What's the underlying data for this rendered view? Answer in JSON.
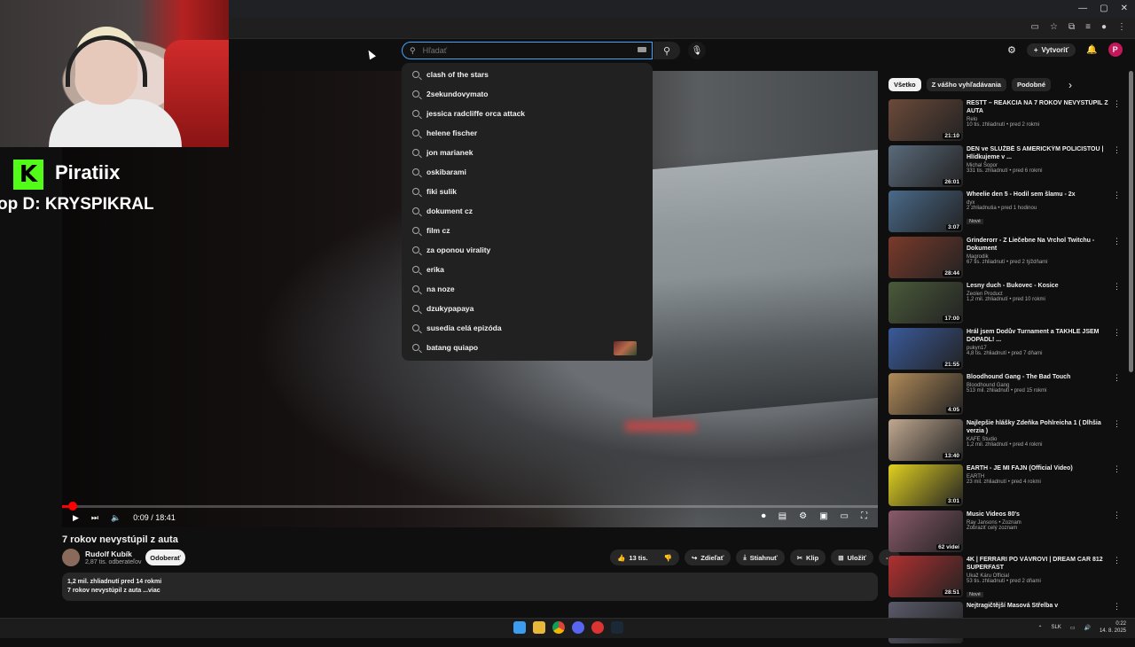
{
  "overlay": {
    "streamer": "Piratiix",
    "drop_text": "op D: KRYSPIKRAL",
    "logo_letter": "K"
  },
  "header": {
    "search_placeholder": "Hľadať",
    "create_label": "Vytvoriť",
    "avatar_letter": "P"
  },
  "suggestions": [
    "clash of the stars",
    "2sekundovymato",
    "jessica radcliffe orca attack",
    "helene fischer",
    "jon marianek",
    "oskibarami",
    "fiki sulik",
    "dokument cz",
    "film cz",
    "za oponou virality",
    "erika",
    "na noze",
    "dzukypapaya",
    "susedia celá epizóda",
    "batang quiapo"
  ],
  "player": {
    "time": "0:09 / 18:41",
    "progress_fraction": 0.008
  },
  "video": {
    "title": "7 rokov nevystúpil z auta",
    "channel": "Rudolf Kubík",
    "subscribers": "2,87 tis. odberateľov",
    "subscribe_label": "Odoberať",
    "likes": "13 tis.",
    "share": "Zdieľať",
    "download": "Stiahnuť",
    "clip": "Klip",
    "save": "Uložiť",
    "desc_line1": "1,2 mil. zhliadnutí  pred 14 rokmi",
    "desc_line2": "7 rokov nevystúpil z auta ...viac"
  },
  "chips": [
    "Všetko",
    "Z vášho vyhľadávania",
    "Podobné"
  ],
  "recommendations": [
    {
      "title": "RESTT – REAKCIA NA 7 ROKOV NEVYSTÚPIL Z AUTA",
      "channel": "Relo",
      "meta": "10 tis. zhliadnutí • pred 2 rokmi",
      "duration": "21:10",
      "color": "#6b4a3a"
    },
    {
      "title": "DEN ve SLUŽBĚ S AMERICKÝM POLICISTOU | Hlídkujeme v ...",
      "channel": "Michal Šopor",
      "meta": "331 tis. zhliadnutí • pred 6 rokmi",
      "duration": "26:01",
      "color": "#5a6a7a"
    },
    {
      "title": "Wheelie den 5 - Hodil sem šlamu - 2x",
      "channel": "dyx",
      "meta": "2 zhliadnutia • pred 1 hodinou",
      "duration": "3:07",
      "badge": "Nové",
      "color": "#4a6a8a"
    },
    {
      "title": "Grinderorr - Z Liečebne Na Vrchol Twitchu - Dokument",
      "channel": "Magrodik",
      "meta": "67 tis. zhliadnutí • pred 2 týždňami",
      "duration": "28:44",
      "color": "#7a3a2a"
    },
    {
      "title": "Lesny duch - Bukovec - Kosice",
      "channel": "Zeolen Product",
      "meta": "1,2 mil. zhliadnutí • pred 10 rokmi",
      "duration": "17:00",
      "color": "#4a5a3a"
    },
    {
      "title": "Hrál jsem Dodův Turnament a TAKHLE JSEM DOPADL! ...",
      "channel": "pukyn17",
      "meta": "4,8 tis. zhliadnutí • pred 7 dňami",
      "duration": "21:55",
      "color": "#3a5a9a"
    },
    {
      "title": "Bloodhound Gang - The Bad Touch",
      "channel": "Bloodhound Gang",
      "meta": "513 mil. zhliadnutí • pred 15 rokmi",
      "duration": "4:05",
      "color": "#b08a5a"
    },
    {
      "title": "Najlepšie hlášky Zdeňka Pohlreicha 1 ( Dlhšia verzia )",
      "channel": "KAFE Studio",
      "meta": "1,2 mil. zhliadnutí • pred 4 rokmi",
      "duration": "13:40",
      "color": "#c0a890"
    },
    {
      "title": "EARTH - JE MI FAJN (Official Video)",
      "channel": "EARTH",
      "meta": "23 mil. zhliadnutí • pred 4 rokmi",
      "duration": "3:01",
      "color": "#e0d020"
    },
    {
      "title": "Music Videos 80's",
      "channel": "Ray Jansons • Zoznam",
      "meta": "Zobraziť celý zoznam",
      "duration": "62 videí",
      "color": "#8a5a6a"
    },
    {
      "title": "4K | FERRARI PO VÁVROVI | DREAM CAR 812 SUPERFAST",
      "channel": "Ukaž Káru Official",
      "meta": "53 tis. zhliadnutí • pred 2 dňami",
      "duration": "28:51",
      "badge": "Nové",
      "color": "#b03030"
    },
    {
      "title": "Nejtragičtější Masová Střelba v",
      "channel": "",
      "meta": "",
      "duration": "",
      "color": "#5a5a6a"
    }
  ],
  "taskbar": {
    "lang": "SLK",
    "time": "0:22",
    "date": "14. 8. 2025"
  },
  "colors": {
    "accent": "#3ea6ff",
    "progress": "#ff0000",
    "kick": "#53fc18"
  }
}
